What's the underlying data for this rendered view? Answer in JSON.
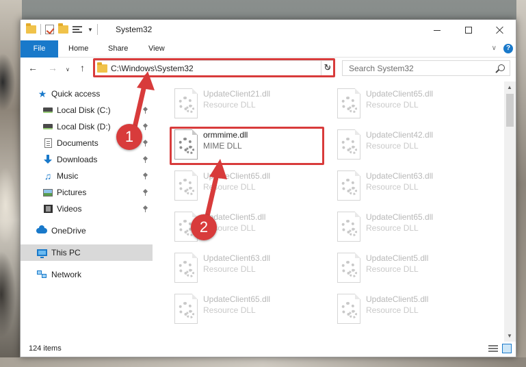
{
  "window": {
    "title": "System32"
  },
  "ribbon": {
    "tabs": [
      "File",
      "Home",
      "Share",
      "View"
    ]
  },
  "address": {
    "path": "C:\\Windows\\System32"
  },
  "search": {
    "placeholder": "Search System32"
  },
  "navpane": {
    "items": [
      {
        "label": "Quick access",
        "icon": "star-icon"
      },
      {
        "label": "Local Disk (C:)",
        "icon": "drive-icon"
      },
      {
        "label": "Local Disk (D:)",
        "icon": "drive-icon"
      },
      {
        "label": "Documents",
        "icon": "documents-icon"
      },
      {
        "label": "Downloads",
        "icon": "download-icon"
      },
      {
        "label": "Music",
        "icon": "music-icon"
      },
      {
        "label": "Pictures",
        "icon": "pictures-icon"
      },
      {
        "label": "Videos",
        "icon": "videos-icon"
      },
      {
        "label": "OneDrive",
        "icon": "cloud-icon"
      },
      {
        "label": "This PC",
        "icon": "pc-icon"
      },
      {
        "label": "Network",
        "icon": "network-icon"
      }
    ]
  },
  "files": [
    {
      "name": "UpdateClient21.dll",
      "desc": "Resource DLL"
    },
    {
      "name": "UpdateClient65.dll",
      "desc": "Resource DLL"
    },
    {
      "name": "ormmime.dll",
      "desc": "MIME DLL"
    },
    {
      "name": "UpdateClient42.dll",
      "desc": "Resource DLL"
    },
    {
      "name": "UpdateClient65.dll",
      "desc": "Resource DLL"
    },
    {
      "name": "UpdateClient63.dll",
      "desc": "Resource DLL"
    },
    {
      "name": "UpdateClient5.dll",
      "desc": "Resource DLL"
    },
    {
      "name": "UpdateClient65.dll",
      "desc": "Resource DLL"
    },
    {
      "name": "UpdateClient63.dll",
      "desc": "Resource DLL"
    },
    {
      "name": "UpdateClient5.dll",
      "desc": "Resource DLL"
    },
    {
      "name": "UpdateClient65.dll",
      "desc": "Resource DLL"
    },
    {
      "name": "UpdateClient5.dll",
      "desc": "Resource DLL"
    }
  ],
  "status": {
    "items": "124 items"
  },
  "annotations": {
    "step1": "1",
    "step2": "2"
  },
  "colors": {
    "accent": "#1979ca",
    "highlight": "#d83b3b"
  }
}
